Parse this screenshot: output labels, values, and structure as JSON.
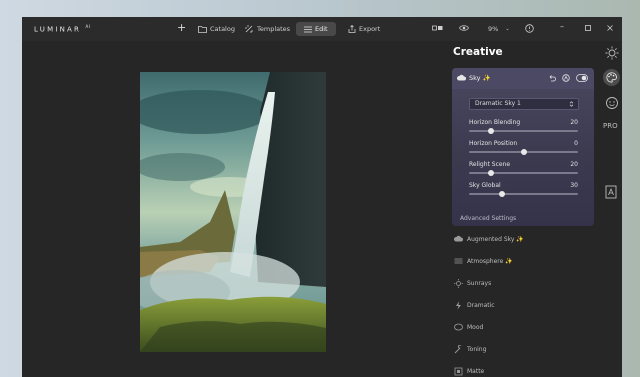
{
  "app": {
    "logo": "LUMINAR",
    "logo_sup": "AI"
  },
  "toolbar": {
    "catalog": "Catalog",
    "templates": "Templates",
    "edit": "Edit",
    "export": "Export",
    "zoom": "9%"
  },
  "panel": {
    "title": "Creative",
    "sky_card": {
      "title": "Sky ✨",
      "preset": "Dramatic Sky 1",
      "sliders": [
        {
          "label": "Horizon Blending",
          "value": "20",
          "level": 0.2
        },
        {
          "label": "Horizon Position",
          "value": "0",
          "level": 0.5
        },
        {
          "label": "Relight Scene",
          "value": "20",
          "level": 0.2
        },
        {
          "label": "Sky Global",
          "value": "30",
          "level": 0.3
        }
      ],
      "advanced": "Advanced Settings"
    },
    "tools": [
      {
        "label": "Augmented Sky ✨",
        "icon": "cloud-icon"
      },
      {
        "label": "Atmosphere ✨",
        "icon": "atmosphere-icon"
      },
      {
        "label": "Sunrays",
        "icon": "sunrays-icon"
      },
      {
        "label": "Dramatic",
        "icon": "dramatic-icon"
      },
      {
        "label": "Mood",
        "icon": "mood-icon"
      },
      {
        "label": "Toning",
        "icon": "toning-icon"
      },
      {
        "label": "Matte",
        "icon": "matte-icon"
      }
    ]
  },
  "rail": {
    "pro_label": "PRO"
  },
  "colors": {
    "accent_card": "#4a4860",
    "window_bg": "#262626"
  }
}
